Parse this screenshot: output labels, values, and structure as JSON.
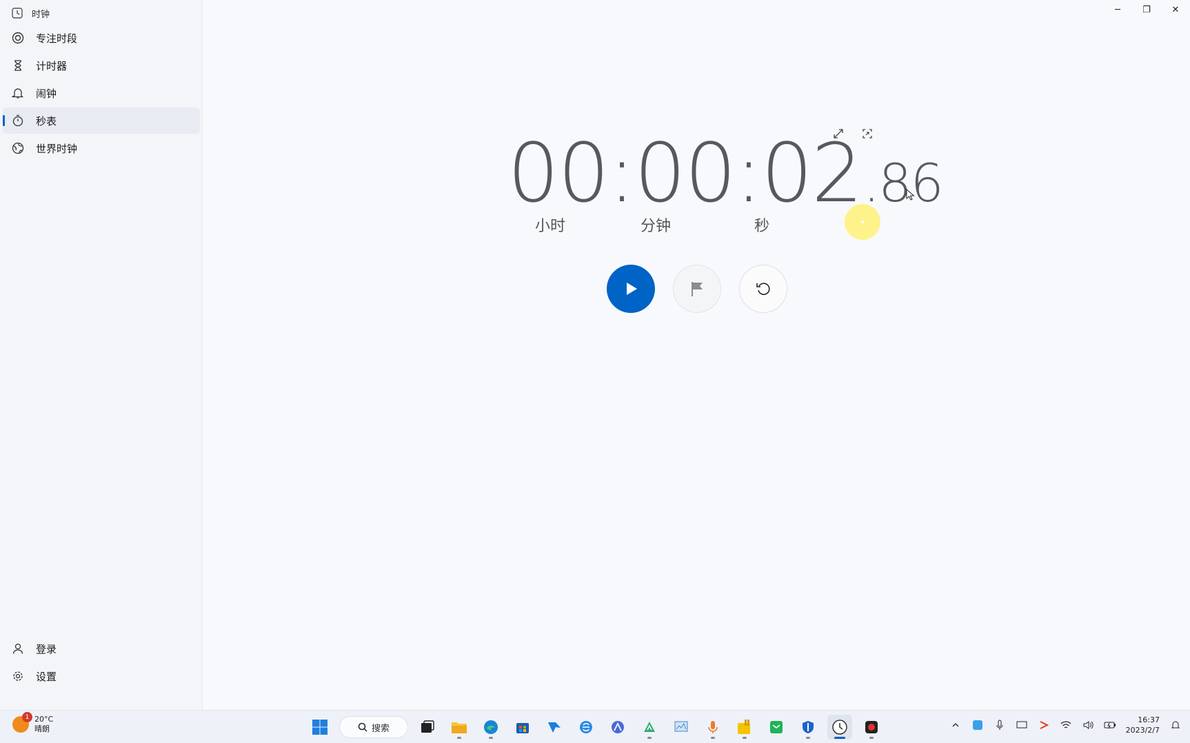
{
  "app": {
    "title": "时钟"
  },
  "sidebar": {
    "items": [
      {
        "label": "专注时段",
        "icon": "focus-icon"
      },
      {
        "label": "计时器",
        "icon": "hourglass-icon"
      },
      {
        "label": "闹钟",
        "icon": "bell-icon"
      },
      {
        "label": "秒表",
        "icon": "stopwatch-icon",
        "active": true
      },
      {
        "label": "世界时钟",
        "icon": "globe-icon"
      }
    ],
    "bottom": [
      {
        "label": "登录",
        "icon": "person-icon"
      },
      {
        "label": "设置",
        "icon": "gear-icon"
      }
    ]
  },
  "window_controls": {
    "minimize": "─",
    "restore": "❐",
    "close": "✕"
  },
  "stopwatch": {
    "time_main": "00:00:02",
    "time_fraction": ".86",
    "units": {
      "hours": "小时",
      "minutes": "分钟",
      "seconds": "秒"
    }
  },
  "colors": {
    "accent": "#0063c6",
    "digits": "#555a5f"
  },
  "taskbar": {
    "weather": {
      "temp": "20°C",
      "desc": "晴朗",
      "badge": "1"
    },
    "search_label": "搜索",
    "clock": {
      "time": "16:37",
      "date": "2023/2/7"
    }
  }
}
